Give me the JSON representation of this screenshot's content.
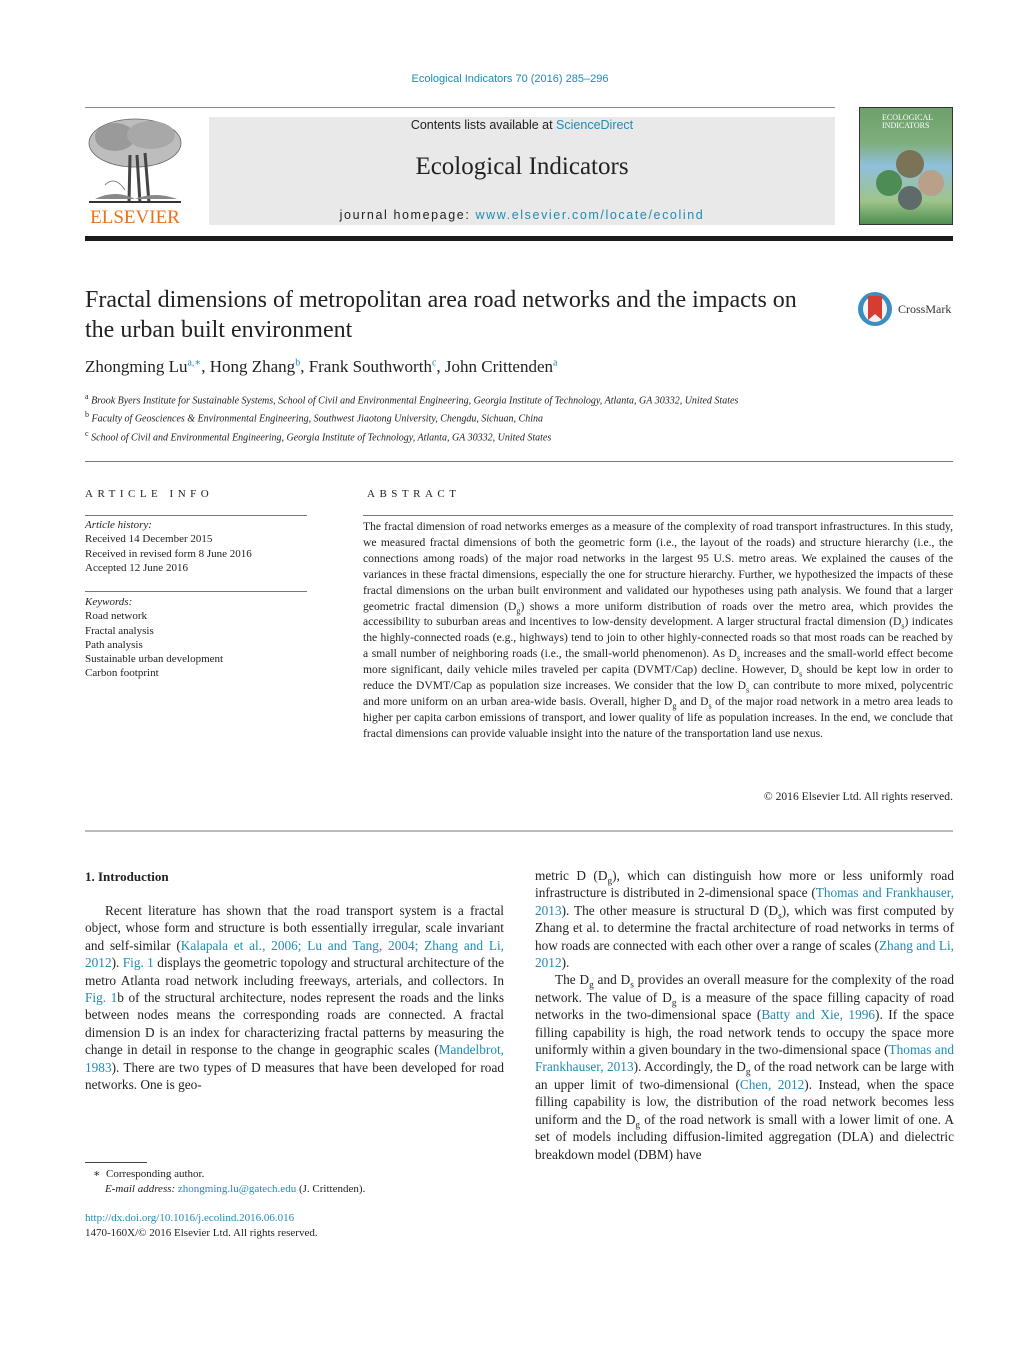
{
  "journal": {
    "citation": "Ecological Indicators 70 (2016) 285–296",
    "contents_prefix": "Contents lists available at ",
    "contents_link": "ScienceDirect",
    "name": "Ecological Indicators",
    "homepage_prefix": "journal homepage: ",
    "homepage_link": "www.elsevier.com/locate/ecolind",
    "publisher": "ELSEVIER",
    "cover_title_1": "ECOLOGICAL",
    "cover_title_2": "INDICATORS"
  },
  "colors": {
    "link": "#1f8bb5",
    "elsevier_orange": "#e9711c",
    "banner_gray": "#e9e9e9",
    "crossmark_blue": "#3b8ec2",
    "crossmark_red": "#d63c2f"
  },
  "article": {
    "title": "Fractal dimensions of metropolitan area road networks and the impacts on the urban built environment",
    "crossmark_label": "CrossMark",
    "authors": [
      {
        "name": "Zhongming Lu",
        "sup": "a,∗",
        "sep": ", "
      },
      {
        "name": "Hong Zhang",
        "sup": "b",
        "sep": ", "
      },
      {
        "name": "Frank Southworth",
        "sup": "c",
        "sep": ", "
      },
      {
        "name": "John Crittenden",
        "sup": "a",
        "sep": ""
      }
    ],
    "affiliations": [
      {
        "key": "a",
        "text": "Brook Byers Institute for Sustainable Systems, School of Civil and Environmental Engineering, Georgia Institute of Technology, Atlanta, GA 30332, United States"
      },
      {
        "key": "b",
        "text": "Faculty of Geosciences & Environmental Engineering, Southwest Jiaotong University, Chengdu, Sichuan, China"
      },
      {
        "key": "c",
        "text": "School of Civil and Environmental Engineering, Georgia Institute of Technology, Atlanta, GA 30332, United States"
      }
    ]
  },
  "article_info": {
    "heading": "ARTICLE INFO",
    "history_label": "Article history:",
    "history": [
      "Received 14 December 2015",
      "Received in revised form 8 June 2016",
      "Accepted 12 June 2016"
    ],
    "keywords_label": "Keywords:",
    "keywords": [
      "Road network",
      "Fractal analysis",
      "Path analysis",
      "Sustainable urban development",
      "Carbon footprint"
    ]
  },
  "abstract": {
    "heading": "ABSTRACT",
    "p1": "The fractal dimension of road networks emerges as a measure of the complexity of road transport infrastructures. In this study, we measured fractal dimensions of both the geometric form (i.e., the layout of the roads) and structure hierarchy (i.e., the connections among roads) of the major road networks in the largest 95 U.S. metro areas. We explained the causes of the variances in these fractal dimensions, especially the one for structure hierarchy. Further, we hypothesized the impacts of these fractal dimensions on the urban built environment and validated our hypotheses using path analysis. We found that a larger geometric fractal dimension (D",
    "sub_g": "g",
    "p2": ") shows a more uniform distribution of roads over the metro area, which provides the accessibility to suburban areas and incentives to low-density development. A larger structural fractal dimension (D",
    "sub_s": "s",
    "p3": ") indicates the highly-connected roads (e.g., highways) tend to join to other highly-connected roads so that most roads can be reached by a small number of neighboring roads (i.e., the small-world phenomenon). As D",
    "p4": " increases and the small-world effect become more significant, daily vehicle miles traveled per capita (DVMT/Cap) decline. However, D",
    "p5": " should be kept low in order to reduce the DVMT/Cap as population size increases. We consider that the low D",
    "p6": " can contribute to more mixed, polycentric and more uniform on an urban area-wide basis. Overall, higher D",
    "p7": " and D",
    "p8": " of the major road network in a metro area leads to higher per capita carbon emissions of transport, and lower quality of life as population increases. In the end, we conclude that fractal dimensions can provide valuable insight into the nature of the transportation land use nexus.",
    "copyright": "© 2016 Elsevier Ltd. All rights reserved."
  },
  "intro": {
    "heading": "1.  Introduction",
    "c1_a": "Recent literature has shown that the road transport system is a fractal object, whose form and structure is both essentially irregular, scale invariant and self-similar (",
    "c1_ref1": "Kalapala et al., 2006; Lu and Tang, 2004; Zhang and Li, 2012",
    "c1_b": "). ",
    "c1_ref2": "Fig. 1",
    "c1_c": " displays the geometric topology and structural architecture of the metro Atlanta road network including freeways, arterials, and collectors. In ",
    "c1_ref3": "Fig. 1",
    "c1_d": "b of the structural architecture, nodes represent the roads and the links between nodes means the corresponding roads are connected. A fractal dimension D is an index for characterizing fractal patterns by measuring the change in detail in response to the change in geographic scales (",
    "c1_ref4": "Mandelbrot, 1983",
    "c1_e": "). There are two types of D measures that have been developed for road networks. One is geo-",
    "c2_a": "metric D (D",
    "c2_b": "), which can distinguish how more or less uniformly road infrastructure is distributed in 2-dimensional space (",
    "c2_ref1": "Thomas and Frankhauser, 2013",
    "c2_c": "). The other measure is structural D (D",
    "c2_d": "), which was first computed by Zhang et al. to determine the fractal architecture of road networks in terms of how roads are connected with each other over a range of scales (",
    "c2_ref2": "Zhang and Li, 2012",
    "c2_e": ").",
    "c3_a": "The D",
    "c3_b": " and D",
    "c3_c": " provides an overall measure for the complexity of the road network. The value of D",
    "c3_d": " is a measure of the space filling capacity of road networks in the two-dimensional space (",
    "c3_ref1": "Batty and Xie, 1996",
    "c3_e": "). If the space filling capability is high, the road network tends to occupy the space more uniformly within a given boundary in the two-dimensional space (",
    "c3_ref2": "Thomas and Frankhauser, 2013",
    "c3_f": "). Accordingly, the D",
    "c3_g": " of the road network can be large with an upper limit of two-dimensional (",
    "c3_ref3": "Chen, 2012",
    "c3_h": "). Instead, when the space filling capability is low, the distribution of the road network becomes less uniform and the D",
    "c3_i": " of the road network is small with a lower limit of one. A set of models including diffusion-limited aggregation (DLA) and dielectric breakdown model (DBM) have"
  },
  "footnotes": {
    "star": "∗",
    "corresponding": "Corresponding author.",
    "email_label": "E-mail address: ",
    "email": "zhongming.lu@gatech.edu",
    "email_suffix": " (J. Crittenden).",
    "doi": "http://dx.doi.org/10.1016/j.ecolind.2016.06.016",
    "issn": "1470-160X/© 2016 Elsevier Ltd. All rights reserved."
  }
}
